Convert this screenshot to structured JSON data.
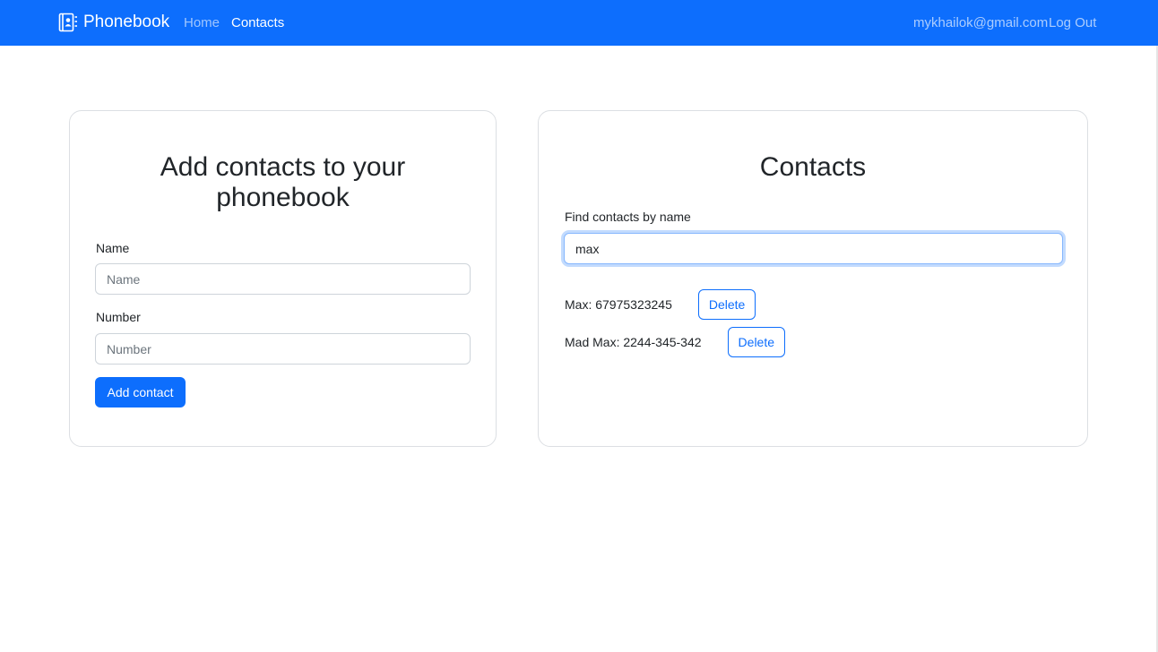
{
  "navbar": {
    "brand": "Phonebook",
    "links": [
      {
        "label": "Home"
      },
      {
        "label": "Contacts"
      }
    ],
    "user_email": "mykhailok@gmail.com",
    "logout_label": "Log Out",
    "bg_color": "#0d6efd",
    "brand_icon": "address-book-icon"
  },
  "add_form": {
    "title": "Add contacts to your phonebook",
    "name_label": "Name",
    "name_placeholder": "Name",
    "name_value": "",
    "number_label": "Number",
    "number_placeholder": "Number",
    "number_value": "",
    "submit_label": "Add contact"
  },
  "contacts": {
    "title": "Contacts",
    "filter_label": "Find contacts by name",
    "filter_value": "max",
    "delete_label": "Delete",
    "items": [
      {
        "text": "Max: 67975323245"
      },
      {
        "text": "Mad Max: 2244-345-342"
      }
    ]
  }
}
